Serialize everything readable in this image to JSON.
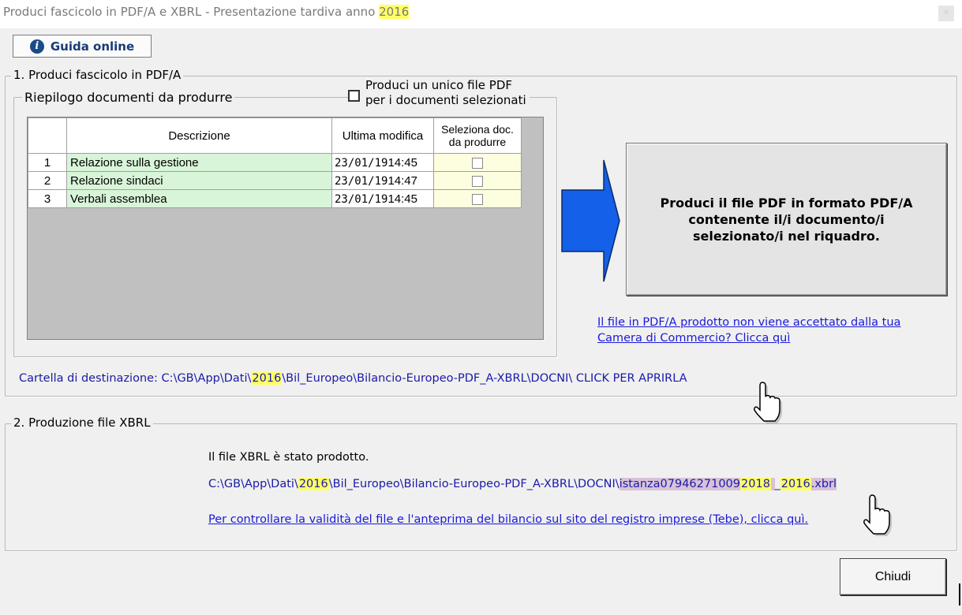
{
  "window": {
    "title": "Produci fascicolo in PDF/A e XBRL - Presentazione tardiva anno ",
    "title_year": "2016"
  },
  "guida": {
    "label": "Guida online",
    "icon": "info-icon"
  },
  "section1": {
    "legend": "1. Produci fascicolo in PDF/A",
    "riepilogo_legend": "Riepilogo documenti da produrre",
    "single_pdf": {
      "line1": "Produci un unico file PDF",
      "line2": "per i documenti selezionati",
      "checked": false
    },
    "table": {
      "headers": {
        "num": "",
        "descrizione": "Descrizione",
        "ultima_modifica": "Ultima modifica",
        "seleziona_line1": "Seleziona doc.",
        "seleziona_line2": "da produrre"
      },
      "rows": [
        {
          "num": "1",
          "descrizione": "Relazione sulla gestione",
          "date": "23/01/19",
          "time": "14:45",
          "selected": false
        },
        {
          "num": "2",
          "descrizione": "Relazione sindaci",
          "date": "23/01/19",
          "time": "14:47",
          "selected": false
        },
        {
          "num": "3",
          "descrizione": "Verbali assemblea",
          "date": "23/01/19",
          "time": "14:45",
          "selected": false
        }
      ]
    },
    "produce_button": {
      "line1": "Produci il file PDF in formato PDF/A",
      "line2": "contenente il/i documento/i",
      "line3": "selezionato/i nel riquadro."
    },
    "pdfa_link": {
      "line1": "Il file in PDF/A prodotto non viene accettato dalla tua",
      "line2": "Camera di Commercio? Clicca quì"
    },
    "destination": {
      "prefix": "Cartella di destinazione: C:\\GB\\App\\Dati\\",
      "year": "2016",
      "suffix": "\\Bil_Europeo\\Bilancio-Europeo-PDF_A-XBRL\\DOCNI\\ CLICK PER APRIRLA"
    }
  },
  "section2": {
    "legend": "2. Produzione file XBRL",
    "produced_text": "Il file XBRL è stato prodotto.",
    "path": {
      "prefix": "C:\\GB\\App\\Dati\\",
      "year": "2016",
      "middle": "\\Bil_Europeo\\Bilancio-Europeo-PDF_A-XBRL\\DOCNI\\",
      "filename": "istanza07946271009",
      "year2": "2018",
      "sep": "_",
      "year3": "2016",
      "ext": ".xbrl"
    },
    "validity_link": "Per controllare la validità del file e l'anteprima del bilancio sul sito del registro imprese (Tebe), clicca quì."
  },
  "close_button": {
    "label": "Chiudi"
  },
  "colors": {
    "highlight": "#ffff66",
    "arrow_fill": "#1560e8",
    "link": "#1a1ad8",
    "filename_highlight": "#d8c2d8",
    "grid_background": "#c0c0c0",
    "description_cell": "#d9f5d9"
  }
}
